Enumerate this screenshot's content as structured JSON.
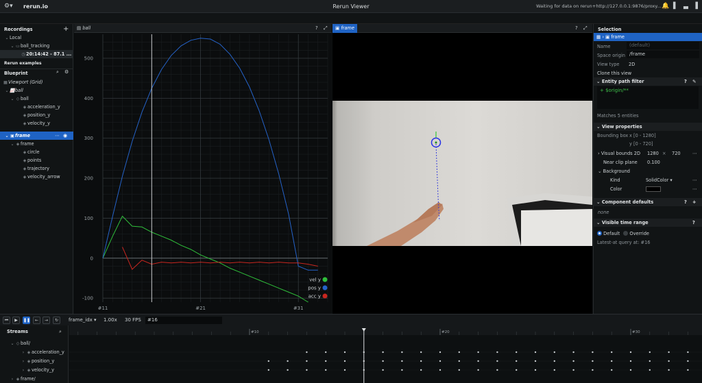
{
  "app": {
    "window_title": "Rerun Viewer",
    "name": "rerun.io",
    "status": "Waiting for data on rerun+http://127.0.0.1:9876/proxy..."
  },
  "recordings": {
    "header": "Recordings",
    "local": "Local",
    "app_id": "ball_tracking",
    "recording": "20:14:42 - 87.1 ...",
    "examples": "Rerun examples"
  },
  "blueprint": {
    "header": "Blueprint",
    "viewport": "Viewport (Grid)",
    "ball_view": "ball",
    "ball_entity": "ball",
    "ball_children": [
      "acceleration_y",
      "position_y",
      "velocity_y"
    ],
    "frame_view": "frame",
    "frame_entity": "frame",
    "frame_children": [
      "circle",
      "points",
      "trajectory",
      "velocity_arrow"
    ]
  },
  "plot_tab": {
    "label": "ball"
  },
  "view_tab": {
    "label": "frame"
  },
  "chart_data": {
    "type": "line",
    "x_tick_labels": [
      "#11",
      "#21",
      "#31"
    ],
    "x_range": [
      11,
      34
    ],
    "y_ticks": [
      -100,
      0,
      100,
      200,
      300,
      400,
      500
    ],
    "y_range": [
      -110,
      560
    ],
    "cursor_x": 16,
    "series": [
      {
        "name": "vel y",
        "color": "#2fbf3a",
        "x": [
          11,
          12,
          13,
          14,
          15,
          16,
          17,
          18,
          19,
          20,
          21,
          22,
          23,
          24,
          25,
          26,
          27,
          28,
          29,
          30,
          31,
          32
        ],
        "values": [
          0,
          55,
          105,
          80,
          78,
          65,
          55,
          45,
          32,
          22,
          8,
          -2,
          -12,
          -25,
          -35,
          -45,
          -55,
          -65,
          -75,
          -85,
          -95,
          -110
        ]
      },
      {
        "name": "pos y",
        "color": "#2563c9",
        "x": [
          11,
          12,
          13,
          14,
          15,
          16,
          17,
          18,
          19,
          20,
          21,
          22,
          23,
          24,
          25,
          26,
          27,
          28,
          29,
          30,
          31,
          32,
          33
        ],
        "values": [
          0,
          105,
          205,
          292,
          365,
          425,
          472,
          507,
          531,
          545,
          550,
          548,
          535,
          510,
          475,
          428,
          368,
          296,
          210,
          110,
          -20,
          -30,
          -30
        ]
      },
      {
        "name": "acc y",
        "color": "#c8261f",
        "x": [
          13,
          14,
          15,
          16,
          17,
          18,
          19,
          20,
          21,
          22,
          23,
          24,
          25,
          26,
          27,
          28,
          29,
          30,
          31,
          32,
          33
        ],
        "values": [
          28,
          -28,
          -5,
          -15,
          -10,
          -12,
          -10,
          -12,
          -10,
          -12,
          -10,
          -12,
          -10,
          -12,
          -10,
          -12,
          -10,
          -12,
          -12,
          -15,
          -20
        ]
      }
    ]
  },
  "selection": {
    "header": "Selection",
    "item": "frame",
    "name_label": "Name",
    "name_placeholder": "(default)",
    "origin_label": "Space origin",
    "origin_value": "/frame",
    "type_label": "View type",
    "type_value": "2D",
    "clone": "Clone this view",
    "filter_header": "Entity path filter",
    "filter_text": "+ $origin/**",
    "filter_matches": "Matches 5 entities",
    "props_header": "View properties",
    "bbox_label": "Bounding box",
    "bbox_x": "x [0 - 1280]",
    "bbox_y": "y [0 - 720]",
    "vb_label": "Visual bounds 2D",
    "vb_w": "1280",
    "vb_x": "×",
    "vb_h": "720",
    "near_label": "Near clip plane",
    "near_value": "0.100",
    "bg_label": "Background",
    "kind_label": "Kind",
    "kind_value": "SolidColor ▾",
    "color_label": "Color",
    "defaults_header": "Component defaults",
    "defaults_none": "none",
    "time_header": "Visible time range",
    "opt_default": "Default",
    "opt_override": "Override",
    "latest": "Latest-at query at: #16"
  },
  "timebar": {
    "timeline": "frame_idx ▾",
    "speed": "1.00x",
    "fps": "30 FPS",
    "frame": "#16"
  },
  "streams": {
    "header": "Streams",
    "tick_labels": [
      "#10",
      "#20",
      "#30"
    ],
    "rows": [
      "ball/",
      "acceleration_y",
      "position_y",
      "velocity_y",
      "frame/"
    ]
  },
  "colors": {
    "accent": "#1f63c4",
    "vel": "#2fbf3a",
    "pos": "#2563c9",
    "acc": "#c8261f"
  }
}
